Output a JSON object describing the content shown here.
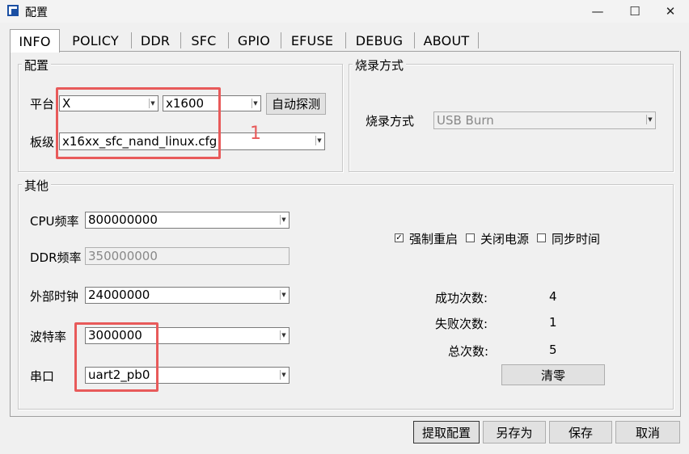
{
  "window": {
    "title": "配置",
    "minimize": "—",
    "maximize": "☐",
    "close": "✕"
  },
  "tabs": [
    {
      "label": "INFO"
    },
    {
      "label": "POLICY"
    },
    {
      "label": "DDR"
    },
    {
      "label": "SFC"
    },
    {
      "label": "GPIO"
    },
    {
      "label": "EFUSE"
    },
    {
      "label": "DEBUG"
    },
    {
      "label": "ABOUT"
    }
  ],
  "config": {
    "group_title": "配置",
    "platform_label": "平台",
    "platform_value": "X",
    "chip_value": "x1600",
    "detect_button": "自动探测",
    "board_label": "板级",
    "board_value": "x16xx_sfc_nand_linux.cfg"
  },
  "burn": {
    "group_title": "烧录方式",
    "mode_label": "烧录方式",
    "mode_value": "USB Burn"
  },
  "other": {
    "group_title": "其他",
    "cpu_label": "CPU频率",
    "cpu_value": "800000000",
    "ddr_label": "DDR频率",
    "ddr_value": "350000000",
    "clock_label": "外部时钟",
    "clock_value": "24000000",
    "baud_label": "波特率",
    "baud_value": "3000000",
    "serial_label": "串口",
    "serial_value": "uart2_pb0",
    "force_reboot": "强制重启",
    "power_off": "关闭电源",
    "sync_time": "同步时间",
    "success_label": "成功次数:",
    "success_value": "4",
    "fail_label": "失败次数:",
    "fail_value": "1",
    "total_label": "总次数:",
    "total_value": "5",
    "clear_button": "清零"
  },
  "footer": {
    "extract_button": "提取配置",
    "save_as_button": "另存为",
    "save_button": "保存",
    "cancel_button": "取消"
  },
  "annotation": {
    "label": "1",
    "color": "#e85a5a"
  },
  "checkbox_states": {
    "force_reboot": true,
    "power_off": false,
    "sync_time": false
  }
}
